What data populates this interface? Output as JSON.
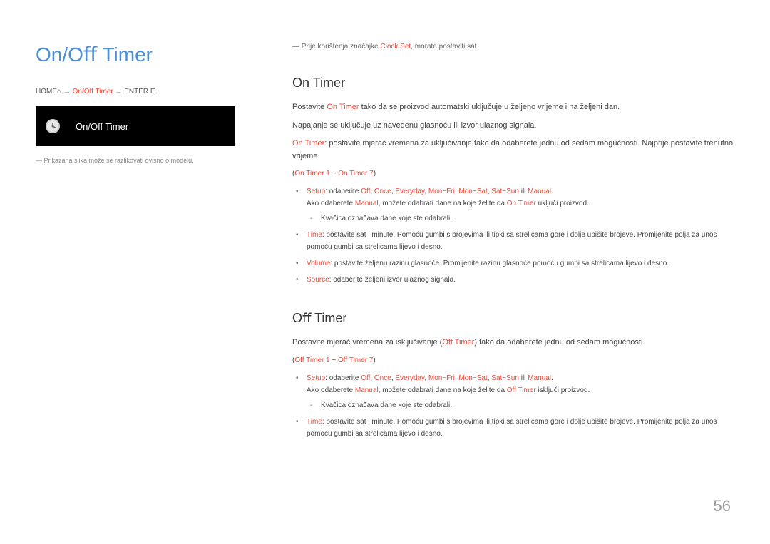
{
  "mainTitle": "On/Oﬀ Timer",
  "nav": {
    "home": "HOME",
    "path": "On/Off Timer",
    "enter": "ENTER E"
  },
  "blackBox": {
    "label": "On/Off Timer"
  },
  "leftNote": "Prikazana slika može se razlikovati ovisno o modelu.",
  "preNote": {
    "prefix": "― Prije korištenja značajke ",
    "hl": "Clock Set",
    "suffix": ", morate postaviti sat."
  },
  "onTimer": {
    "title": "On Timer",
    "p1a": "Postavite ",
    "p1hl": "On Timer",
    "p1b": " tako da se proizvod automatski uključuje u željeno vrijeme i na željeni dan.",
    "p2": "Napajanje se uključuje uz navedenu glasnoću ili izvor ulaznog signala.",
    "p3a": "On Timer",
    "p3b": ": postavite mjerač vremena za uključivanje tako da odaberete jednu od sedam mogućnosti. Najprije postavite trenutno vrijeme.",
    "p4a": "(",
    "p4hl1": "On Timer 1",
    "p4mid": " ~ ",
    "p4hl2": "On Timer 7",
    "p4b": ")",
    "b1": {
      "label": "Setup",
      "text": ": odaberite ",
      "opts": [
        "Off",
        "Once",
        "Everyday",
        "Mon~Fri",
        "Mon~Sat",
        "Sat~Sun"
      ],
      "or": " ili ",
      "last": "Manual",
      "line2a": "Ako odaberete ",
      "line2hl1": "Manual",
      "line2b": ", možete odabrati dane na koje želite da ",
      "line2hl2": "On Timer",
      "line2c": " uključi proizvod.",
      "sub": "Kvačica označava dane koje ste odabrali."
    },
    "b2": {
      "label": "Time",
      "text": ": postavite sat i minute. Pomoću gumbi s brojevima ili tipki sa strelicama gore i dolje upišite brojeve. Promijenite polja za unos pomoću gumbi sa strelicama lijevo i desno."
    },
    "b3": {
      "label": "Volume",
      "text": ": postavite željenu razinu glasnoće. Promijenite razinu glasnoće pomoću gumbi sa strelicama lijevo i desno."
    },
    "b4": {
      "label": "Source",
      "text": ": odaberite željeni izvor ulaznog signala."
    }
  },
  "offTimer": {
    "title": "Oﬀ Timer",
    "p1a": "Postavite mjerač vremena za isključivanje (",
    "p1hl": "Off Timer",
    "p1b": ") tako da odaberete jednu od sedam mogućnosti.",
    "p2a": "(",
    "p2hl1": "Off Timer 1",
    "p2mid": " ~ ",
    "p2hl2": "Off Timer 7",
    "p2b": ")",
    "b1": {
      "label": "Setup",
      "text": ": odaberite ",
      "opts": [
        "Off",
        "Once",
        "Everyday",
        "Mon~Fri",
        "Mon~Sat",
        "Sat~Sun"
      ],
      "or": " ili ",
      "last": "Manual",
      "line2a": "Ako odaberete ",
      "line2hl1": "Manual",
      "line2b": ", možete odabrati dane na koje želite da ",
      "line2hl2": "Off Timer",
      "line2c": " isključi proizvod.",
      "sub": "Kvačica označava dane koje ste odabrali."
    },
    "b2": {
      "label": "Time",
      "text": ": postavite sat i minute. Pomoću gumbi s brojevima ili tipki sa strelicama gore i dolje upišite brojeve. Promijenite polja za unos pomoću gumbi sa strelicama lijevo i desno."
    }
  },
  "pageNumber": "56"
}
